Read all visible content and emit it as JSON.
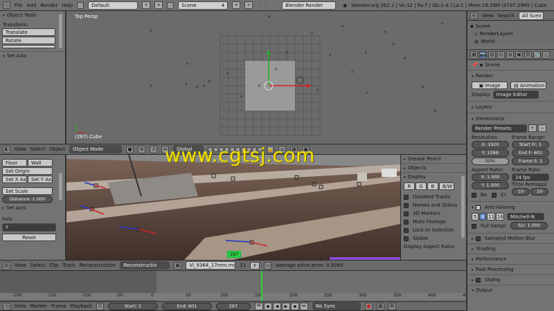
{
  "top": {
    "menus": [
      "File",
      "Add",
      "Render",
      "Help"
    ],
    "layout": "Default",
    "scene": "Scene",
    "scene_users": "4",
    "engine": "Blender Render",
    "stats": "blender.org 262.1 | Ve:12 | Fa:7 | Ob:1-4 | La:1 | Mem:19.39M (4797.29M) | Cube"
  },
  "tools3d": {
    "title": "Object Tools",
    "transform": "Transform:",
    "translate": "Translate",
    "rotate": "Rotate",
    "set_axis": "Set Axis"
  },
  "viewport3d": {
    "label": "Top Persp",
    "object": "(297) Cube",
    "menus": [
      "View",
      "Select",
      "Object"
    ],
    "mode": "Object Mode",
    "orient": "Global"
  },
  "watermark": "www.cgtsj.com",
  "outliner": {
    "menus": [
      "View",
      "Search"
    ],
    "filter": "All Scen",
    "items": [
      "Scene",
      "RenderLayers",
      "World"
    ]
  },
  "properties": {
    "context": "Scene",
    "render": {
      "title": "Render",
      "image_btn": "Image",
      "anim_btn": "Animation",
      "display_label": "Display:",
      "display_value": "Image Editor"
    },
    "layers": "Layers",
    "dimensions": {
      "title": "Dimensions",
      "preset": "Render Presets",
      "resolution": "Resolution:",
      "res_x": "X: 1920",
      "res_y": "Y: 1088",
      "res_pct": "50%",
      "frame_range": "Frame Range:",
      "start": "Start Fr: 1",
      "end": "End F: 601",
      "step": "Frame S: 1",
      "aspect": "Aspect Ratio:",
      "asp_x": "X: 1.000",
      "asp_y": "Y: 1.000",
      "frame_rate": "Frame Rate:",
      "fps": "24 fps",
      "remap": "Time Remappi",
      "bo": "Bo",
      "cr": "Cr",
      "remap_old": "·10·",
      "remap_new": "·10·"
    },
    "aa": {
      "title": "Anti-Aliasing",
      "samples": [
        "5",
        "8",
        "11",
        "16"
      ],
      "filter": "Mitchell-N",
      "full_sample": "Full Sampl",
      "size": "Siz: 1.000"
    },
    "sections": [
      "Sampled Motion Blur",
      "Shading",
      "Performance",
      "Post Processing",
      "Stamp",
      "Output"
    ]
  },
  "clip_tools": {
    "floor": "Floor",
    "wall": "Wall",
    "set_origin": "Set Origin",
    "set_x": "Set X Axis",
    "set_y": "Set Y Axis",
    "set_scale": "Set Scale",
    "distance": "Distance: 1.000",
    "set_axis": "Set Axis",
    "axis_label": "Axis",
    "axis_value": "Y",
    "reset": "Reset"
  },
  "clip_props": {
    "grease_pencil": "Grease Pencil",
    "objects": "Objects",
    "display": "Display",
    "channels": [
      "R",
      "G",
      "B",
      "B/W"
    ],
    "options": [
      "Disabled Tracks",
      "Names and Status",
      "3D Markers",
      "Mute Footage",
      "Lock to Selection",
      "Stable"
    ],
    "aspect_label": "Display Aspect Ratio:"
  },
  "clip_header": {
    "menus": [
      "View",
      "Select",
      "Clip",
      "Track",
      "Reconstruction"
    ],
    "mode": "Reconstructio",
    "file": "VI_9364_17mm.mov",
    "users": "11",
    "f": "F",
    "error": "Average solve error: 0.5080"
  },
  "clip_frame_badge": "297",
  "timeline": {
    "ticks": [
      "-450",
      "-400",
      "-350",
      "-300",
      "-250",
      "-200",
      "-150",
      "-100",
      "-50",
      "0",
      "50",
      "100",
      "150",
      "200",
      "250",
      "300",
      "350",
      "400",
      "450",
      "500",
      "550",
      "600",
      "650",
      "700"
    ],
    "tick_values": [
      -450,
      -400,
      -350,
      -300,
      -250,
      -200,
      -150,
      -100,
      -50,
      0,
      50,
      100,
      150,
      200,
      250,
      300,
      350,
      400,
      450,
      500,
      550,
      600,
      650,
      700
    ],
    "menus": [
      "View",
      "Marker",
      "Frame",
      "Playback"
    ],
    "start": "Start: 1",
    "end": "End: 601",
    "current": "297",
    "current_value": 297,
    "sync": "No Sync"
  },
  "colors": {
    "accent_orange": "#e8a33c",
    "watermark": "#f0e100",
    "axis_x": "#d42020",
    "axis_y": "#20b020",
    "frame_line": "#35d035"
  }
}
